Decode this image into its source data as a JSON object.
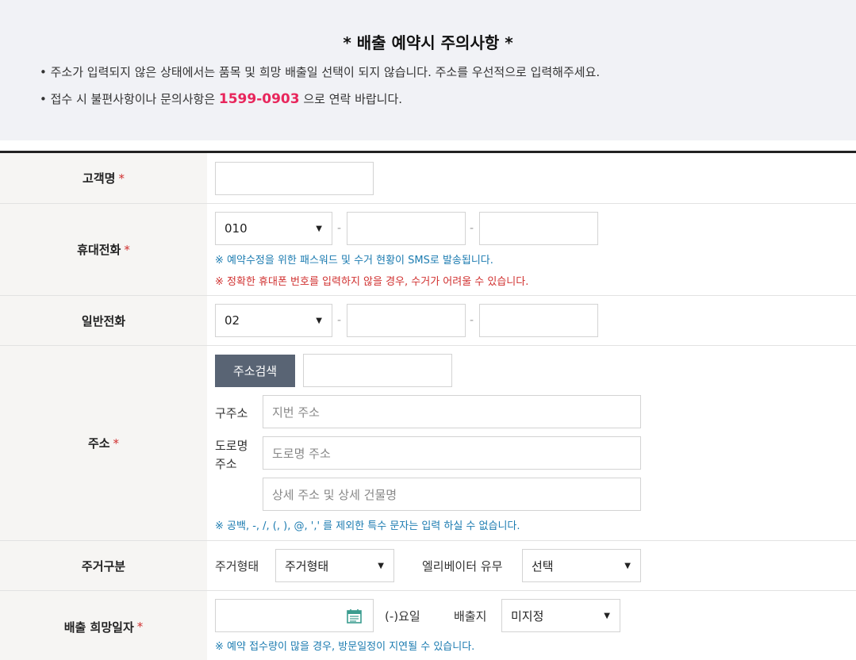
{
  "notice": {
    "title": "*  배출 예약시 주의사항  *",
    "line1": "• 주소가 입력되지 않은 상태에서는 품목 및 희망 배출일 선택이 되지 않습니다. 주소를 우선적으로 입력해주세요.",
    "line2_prefix": "• 접수 시 불편사항이나 문의사항은 ",
    "line2_phone": "1599-0903",
    "line2_suffix": " 으로 연락 바랍니다."
  },
  "form": {
    "required_mark": "*",
    "customer": {
      "label": "고객명",
      "value": ""
    },
    "mobile": {
      "label": "휴대전화",
      "prefix": "010",
      "middle": "",
      "last": "",
      "dash": "-",
      "note_sms": "※ 예약수정을 위한 패스워드 및 수거 현황이 SMS로 발송됩니다.",
      "note_warn": "※ 정확한 휴대폰 번호를 입력하지 않을 경우, 수거가 어려울 수 있습니다."
    },
    "landline": {
      "label": "일반전화",
      "prefix": "02",
      "middle": "",
      "last": "",
      "dash": "-"
    },
    "address": {
      "label": "주소",
      "search_button": "주소검색",
      "zipcode": "",
      "old_label": "구주소",
      "old_placeholder": "지번 주소",
      "road_label_1": "도로명",
      "road_label_2": "주소",
      "road_placeholder": "도로명 주소",
      "detail_placeholder": "상세 주소 및 상세 건물명",
      "note": "※ 공백, -, /, (, ), @, ',' 를 제외한 특수 문자는 입력 하실 수 없습니다."
    },
    "residence": {
      "label": "주거구분",
      "type_label": "주거형태",
      "type_value": "주거형태",
      "elevator_label": "엘리베이터 유무",
      "elevator_value": "선택"
    },
    "date": {
      "label": "배출 희망일자",
      "value": "",
      "weekday": "(-)요일",
      "place_label": "배출지",
      "place_value": "미지정",
      "note": "※ 예약 접수량이 많을 경우, 방문일정이 지연될 수 있습니다."
    }
  },
  "icons": {
    "dropdown": "chevron-down-icon",
    "calendar": "calendar-icon"
  },
  "colors": {
    "accent_phone": "#e8265c",
    "note_blue": "#1b7bb0",
    "note_red": "#d0302f",
    "button_bg": "#596474"
  }
}
